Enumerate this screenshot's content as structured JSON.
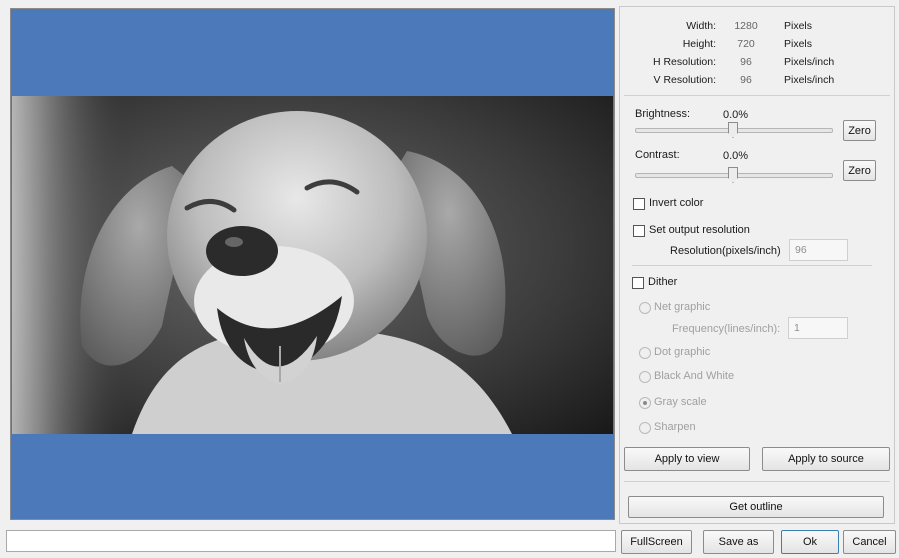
{
  "image_info": {
    "rows": [
      {
        "label": "Width:",
        "value": "1280",
        "unit": "Pixels"
      },
      {
        "label": "Height:",
        "value": "720",
        "unit": "Pixels"
      },
      {
        "label": "H Resolution:",
        "value": "96",
        "unit": "Pixels/inch"
      },
      {
        "label": "V Resolution:",
        "value": "96",
        "unit": "Pixels/inch"
      }
    ]
  },
  "adjust": {
    "brightness_label": "Brightness:",
    "brightness_value": "0.0%",
    "contrast_label": "Contrast:",
    "contrast_value": "0.0%",
    "zero_label": "Zero"
  },
  "options": {
    "invert_label": "Invert color",
    "invert_checked": false,
    "output_res_label": "Set output resolution",
    "output_res_checked": false,
    "resolution_field_label": "Resolution(pixels/inch)",
    "resolution_value": "96",
    "dither_label": "Dither",
    "dither_checked": false,
    "net_graphic_label": "Net graphic",
    "frequency_label": "Frequency(lines/inch):",
    "frequency_value": "1",
    "dot_graphic_label": "Dot graphic",
    "black_white_label": "Black And White",
    "gray_scale_label": "Gray scale",
    "sharpen_label": "Sharpen",
    "selected_mode": "Gray scale"
  },
  "actions": {
    "apply_view": "Apply to view",
    "apply_source": "Apply to source",
    "get_outline": "Get outline"
  },
  "footer": {
    "fullscreen": "FullScreen",
    "save_as": "Save as",
    "ok": "Ok",
    "cancel": "Cancel"
  },
  "preview": {
    "background_color": "#4b79ba",
    "image_subject": "grayscale photo of smiling golden retriever"
  }
}
